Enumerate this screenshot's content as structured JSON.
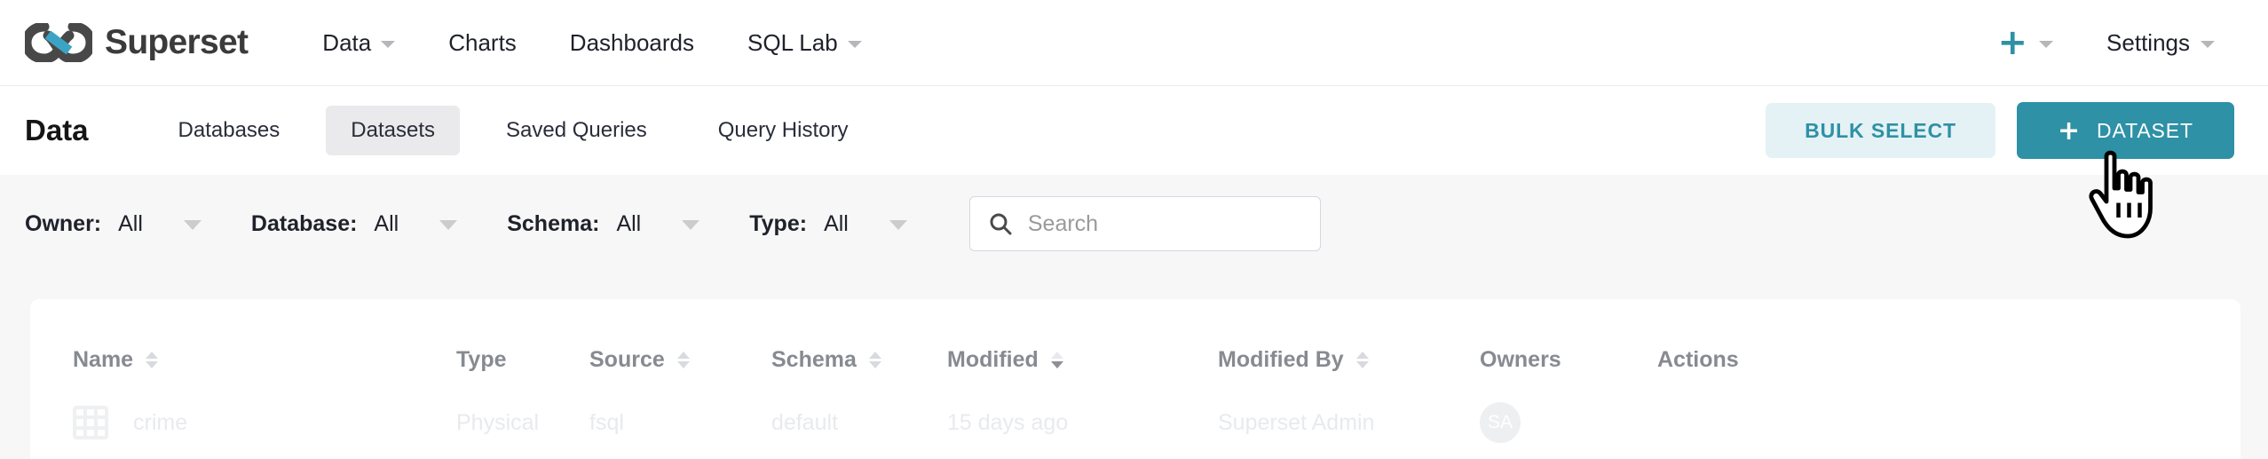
{
  "navbar": {
    "brand": "Superset",
    "logo_icon": "superset-infinity-logo",
    "links": [
      {
        "label": "Data",
        "has_caret": true
      },
      {
        "label": "Charts",
        "has_caret": false
      },
      {
        "label": "Dashboards",
        "has_caret": false
      },
      {
        "label": "SQL Lab",
        "has_caret": true
      }
    ],
    "plus_icon": "plus-icon",
    "plus_glyph": "+",
    "settings_label": "Settings"
  },
  "subheader": {
    "title": "Data",
    "tabs": [
      {
        "label": "Databases",
        "active": false
      },
      {
        "label": "Datasets",
        "active": true
      },
      {
        "label": "Saved Queries",
        "active": false
      },
      {
        "label": "Query History",
        "active": false
      }
    ],
    "bulk_select_label": "BULK SELECT",
    "new_dataset_label": "DATASET",
    "new_dataset_plus": "+"
  },
  "filters": [
    {
      "label": "Owner:",
      "value": "All"
    },
    {
      "label": "Database:",
      "value": "All"
    },
    {
      "label": "Schema:",
      "value": "All"
    },
    {
      "label": "Type:",
      "value": "All"
    }
  ],
  "search": {
    "placeholder": "Search",
    "value": "",
    "icon": "search-icon"
  },
  "table": {
    "columns": [
      {
        "label": "Name",
        "sortable": true,
        "sorted": false
      },
      {
        "label": "Type",
        "sortable": false,
        "sorted": false
      },
      {
        "label": "Source",
        "sortable": true,
        "sorted": false
      },
      {
        "label": "Schema",
        "sortable": true,
        "sorted": false
      },
      {
        "label": "Modified",
        "sortable": true,
        "sorted": true
      },
      {
        "label": "Modified By",
        "sortable": true,
        "sorted": false
      },
      {
        "label": "Owners",
        "sortable": false,
        "sorted": false
      },
      {
        "label": "Actions",
        "sortable": false,
        "sorted": false
      }
    ],
    "rows": [
      {
        "icon": "table-grid-icon",
        "name": "crime",
        "type": "Physical",
        "source": "fsql",
        "schema": "default",
        "modified": "15 days ago",
        "modified_by": "Superset Admin",
        "owner_initials": "SA"
      }
    ]
  },
  "colors": {
    "accent_teal": "#2e91a6",
    "accent_teal_soft": "#e5f2f5",
    "page_bg": "#f7f7f7",
    "card_bg": "#ffffff",
    "tab_active_bg": "#eaeaec",
    "header_text": "#888a92"
  },
  "cursor": {
    "icon": "pointing-hand-cursor"
  }
}
